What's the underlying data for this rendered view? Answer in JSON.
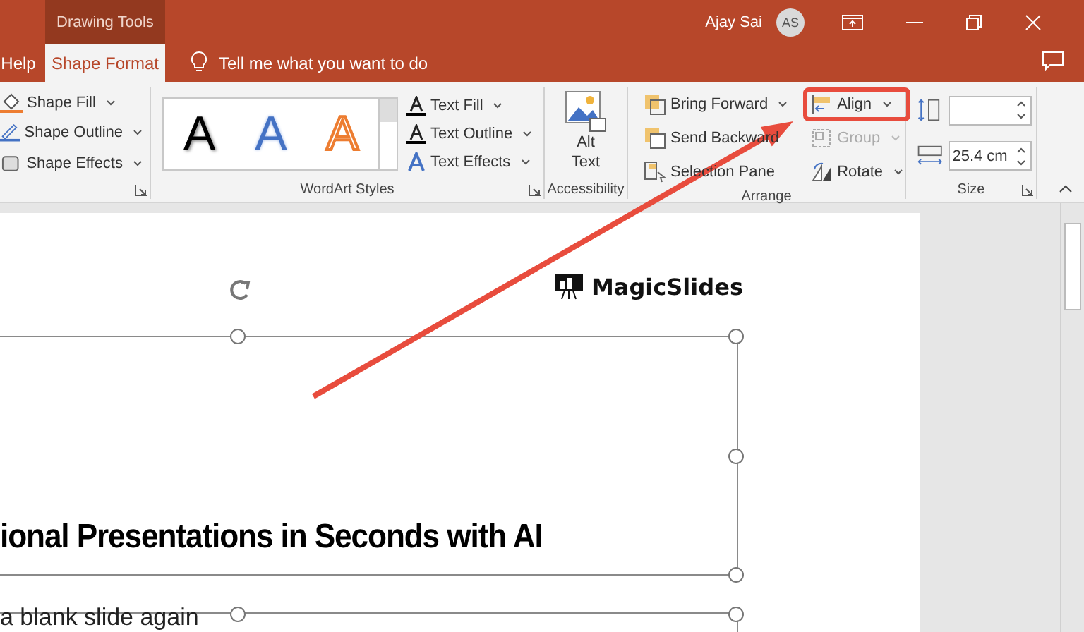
{
  "title_bar": {
    "context_tab": "Drawing Tools",
    "user_name": "Ajay Sai",
    "avatar_initials": "AS"
  },
  "tabs": [
    {
      "label": "Help",
      "selected": false
    },
    {
      "label": "Shape Format",
      "selected": true
    }
  ],
  "tell_me": {
    "placeholder": "Tell me what you want to do"
  },
  "ribbon": {
    "shape_styles": {
      "buttons": [
        {
          "label": "Shape Fill",
          "kind": "fill"
        },
        {
          "label": "Shape Outline",
          "kind": "outline"
        },
        {
          "label": "Shape Effects",
          "kind": "effects"
        }
      ]
    },
    "wordart": {
      "label": "WordArt Styles",
      "samples": [
        {
          "text": "A",
          "kind": "black"
        },
        {
          "text": "A",
          "kind": "blue"
        },
        {
          "text": "A",
          "kind": "orange"
        }
      ],
      "buttons": [
        {
          "label": "Text Fill",
          "kind": "fill"
        },
        {
          "label": "Text Outline",
          "kind": "outline"
        },
        {
          "label": "Text Effects",
          "kind": "effects"
        }
      ]
    },
    "accessibility": {
      "label": "Accessibility",
      "button": "Alt\nText"
    },
    "arrange": {
      "label": "Arrange",
      "buttons": [
        {
          "label": "Bring Forward",
          "kind": "forward",
          "disabled": false,
          "highlighted": false
        },
        {
          "label": "Align",
          "kind": "align",
          "disabled": false,
          "highlighted": true
        },
        {
          "label": "Send Backward",
          "kind": "backward",
          "disabled": false,
          "highlighted": false
        },
        {
          "label": "Group",
          "kind": "group",
          "disabled": true,
          "highlighted": false
        },
        {
          "label": "Selection Pane",
          "kind": "pane",
          "disabled": false,
          "highlighted": false
        },
        {
          "label": "Rotate",
          "kind": "rotate",
          "disabled": false,
          "highlighted": false
        }
      ]
    },
    "size": {
      "label": "Size",
      "width": "25.4 cm"
    }
  },
  "slide": {
    "logo": "MagicSlides",
    "title": "ional Presentations in Seconds with AI",
    "subtitle": "a blank slide again"
  }
}
